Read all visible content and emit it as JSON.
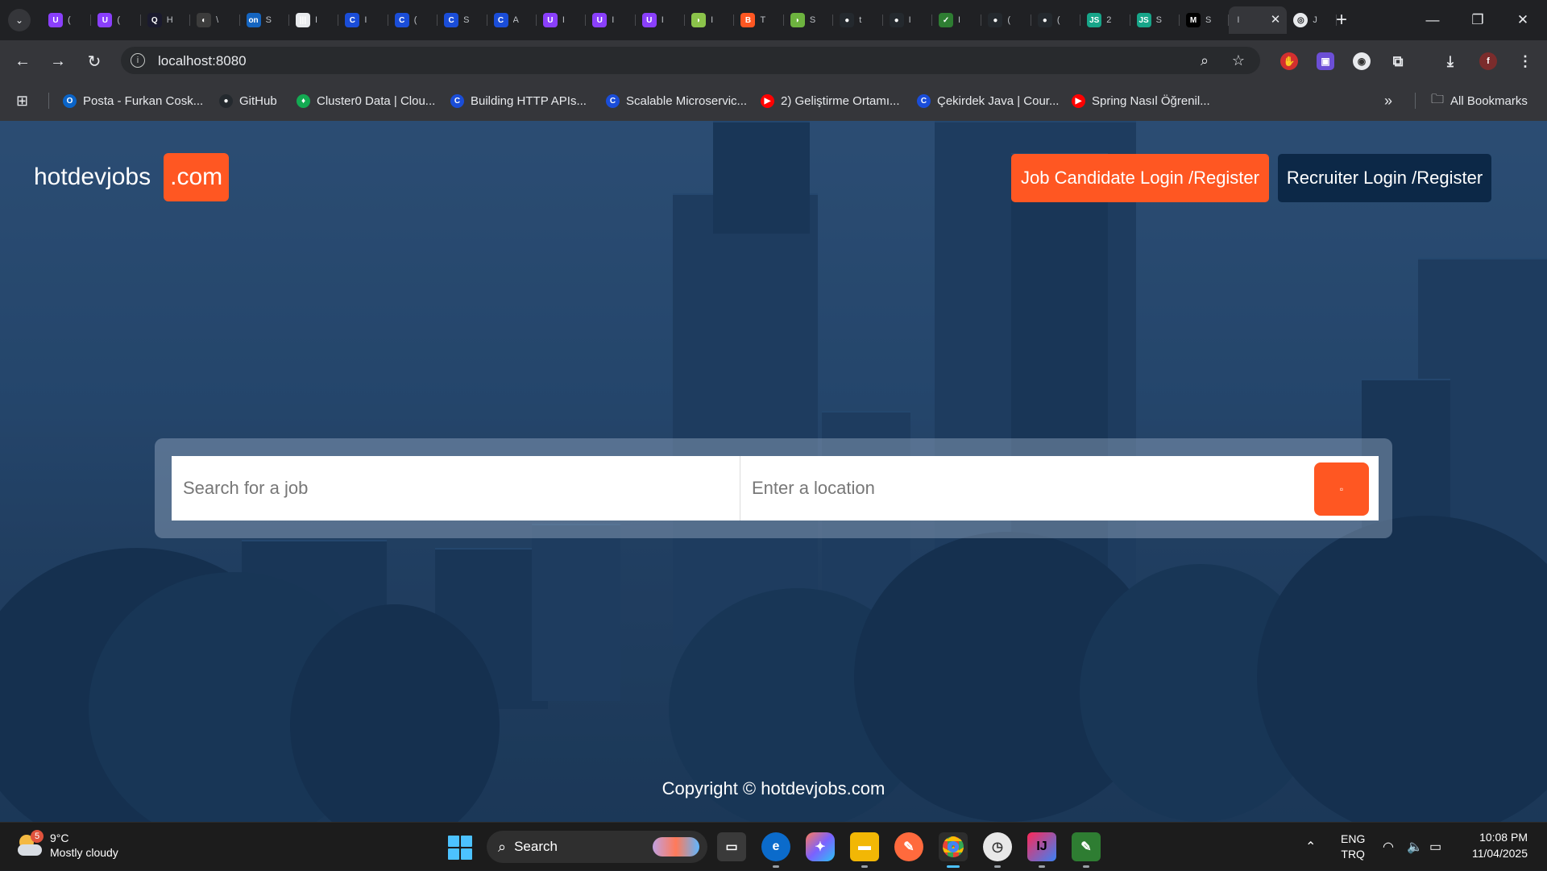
{
  "browser": {
    "tabs": [
      {
        "icon": "U",
        "color": "#8a3ffc",
        "title": "("
      },
      {
        "icon": "U",
        "color": "#8a3ffc",
        "title": "("
      },
      {
        "icon": "Q",
        "color": "#1a1a2e",
        "title": "H"
      },
      {
        "icon": "◐",
        "color": "#3c3c3c",
        "title": "\\"
      },
      {
        "icon": "on",
        "color": "#1565c0",
        "title": "S"
      },
      {
        "icon": "|||",
        "color": "#e8eaed",
        "title": "I"
      },
      {
        "icon": "C",
        "color": "#1a4dd8",
        "title": "I"
      },
      {
        "icon": "C",
        "color": "#1a4dd8",
        "title": "("
      },
      {
        "icon": "C",
        "color": "#1a4dd8",
        "title": "S"
      },
      {
        "icon": "C",
        "color": "#1a4dd8",
        "title": "A"
      },
      {
        "icon": "U",
        "color": "#8a3ffc",
        "title": "I"
      },
      {
        "icon": "U",
        "color": "#8a3ffc",
        "title": "I"
      },
      {
        "icon": "U",
        "color": "#8a3ffc",
        "title": "I"
      },
      {
        "icon": "◗",
        "color": "#8bc34a",
        "title": "I"
      },
      {
        "icon": "B",
        "color": "#ff5722",
        "title": "T"
      },
      {
        "icon": "◗",
        "color": "#6db33f",
        "title": "S"
      },
      {
        "icon": "●",
        "color": "#24292e",
        "title": "t"
      },
      {
        "icon": "●",
        "color": "#24292e",
        "title": "I"
      },
      {
        "icon": "✓",
        "color": "#2e7d32",
        "title": "I"
      },
      {
        "icon": "●",
        "color": "#24292e",
        "title": "("
      },
      {
        "icon": "●",
        "color": "#24292e",
        "title": "("
      },
      {
        "icon": "JS",
        "color": "#17a589",
        "title": "2"
      },
      {
        "icon": "JS",
        "color": "#17a589",
        "title": "S"
      },
      {
        "icon": "M",
        "color": "#000000",
        "title": "S"
      }
    ],
    "active_tab": {
      "title": "I"
    },
    "last_tab": {
      "icon": "◎",
      "title": "J"
    },
    "url": "localhost:8080",
    "bookmarks": [
      {
        "label": "Posta - Furkan Cosk...",
        "color": "#0a64c8",
        "icon": "O"
      },
      {
        "label": "GitHub",
        "color": "#24292e",
        "icon": "●"
      },
      {
        "label": "Cluster0 Data | Clou...",
        "color": "#13aa52",
        "icon": "♦"
      },
      {
        "label": "Building HTTP APIs...",
        "color": "#1a4dd8",
        "icon": "C"
      },
      {
        "label": "Scalable Microservic...",
        "color": "#1a4dd8",
        "icon": "C"
      },
      {
        "label": "2) Geliştirme Ortamı...",
        "color": "#ff0000",
        "icon": "▶"
      },
      {
        "label": "Çekirdek Java | Cour...",
        "color": "#1a4dd8",
        "icon": "C"
      },
      {
        "label": "Spring Nasıl Öğrenil...",
        "color": "#ff0000",
        "icon": "▶"
      }
    ],
    "all_bookmarks": "All Bookmarks"
  },
  "site": {
    "logo_text": "hotdevjobs",
    "logo_com": ".com",
    "candidate_button": "Job Candidate Login /Register",
    "recruiter_button": "Recruiter Login /Register",
    "job_placeholder": "Search for a job",
    "location_placeholder": "Enter a location",
    "footer": "Copyright © hotdevjobs.com"
  },
  "colors": {
    "accent": "#ff5722",
    "navy": "#0c2847"
  },
  "taskbar": {
    "temp": "9°C",
    "weather": "Mostly cloudy",
    "weather_badge": "5",
    "search": "Search",
    "lang1": "ENG",
    "lang2": "TRQ",
    "time": "10:08 PM",
    "date": "11/04/2025"
  }
}
